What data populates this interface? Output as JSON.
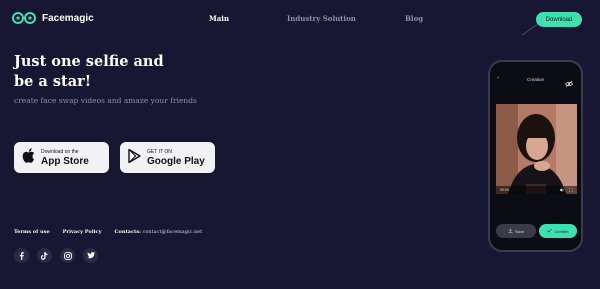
{
  "brand": {
    "name": "Facemagic",
    "accent": "#3ee0b0"
  },
  "nav": {
    "main": "Main",
    "industry": "Industry Solution",
    "blog": "Blog"
  },
  "header": {
    "download_label": "Download"
  },
  "hero": {
    "headline_line1": "Just one selfie and",
    "headline_line2": "be a star!",
    "subline": "create face swap videos and amaze your friends"
  },
  "stores": {
    "appstore_small": "Download on the",
    "appstore_big": "App Store",
    "gplay_small": "GET IT ON",
    "gplay_big": "Google Play"
  },
  "footer": {
    "terms": "Terms of use",
    "privacy": "Privacy Policy",
    "contacts_label": "Contacts:",
    "contacts_value": "contact@facemagic.net"
  },
  "socials": [
    {
      "icon": "facebook-icon"
    },
    {
      "icon": "tiktok-icon"
    },
    {
      "icon": "instagram-icon"
    },
    {
      "icon": "twitter-icon"
    }
  ],
  "phone": {
    "title": "Creation",
    "time": "00:00",
    "save_label": "Save",
    "confirm_label": "Confirm"
  },
  "colors": {
    "background": "#181733",
    "button_light": "#f2f2f4"
  }
}
